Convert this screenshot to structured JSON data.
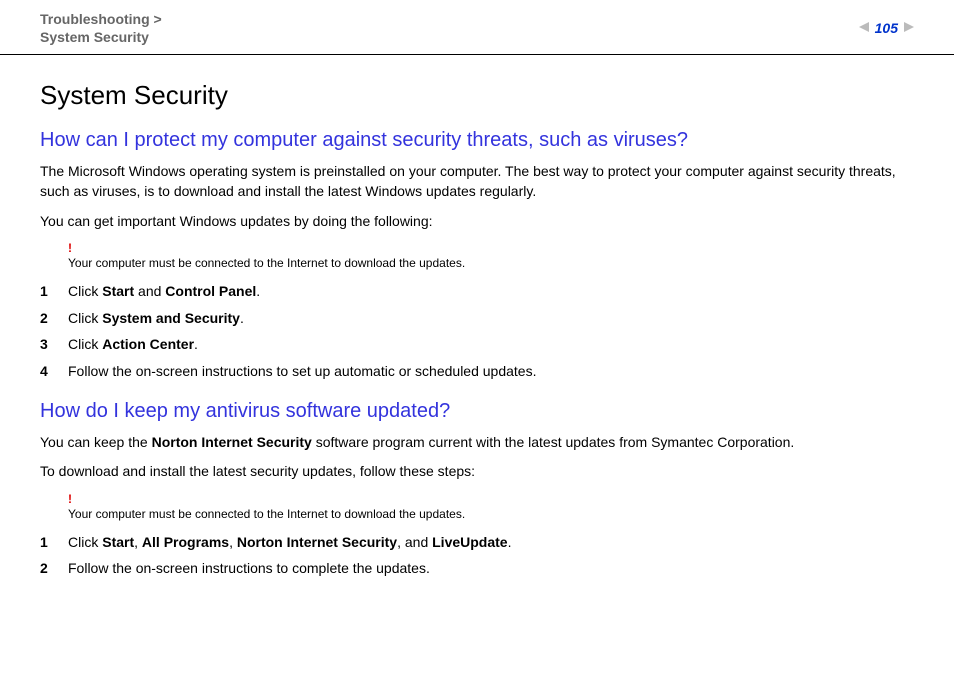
{
  "header": {
    "breadcrumb_line1": "Troubleshooting >",
    "breadcrumb_line2": "System Security",
    "page_number": "105"
  },
  "title": "System Security",
  "section1": {
    "heading": "How can I protect my computer against security threats, such as viruses?",
    "para1": "The Microsoft Windows operating system is preinstalled on your computer. The best way to protect your computer against security threats, such as viruses, is to download and install the latest Windows updates regularly.",
    "para2": "You can get important Windows updates by doing the following:",
    "warning_mark": "!",
    "warning_text": "Your computer must be connected to the Internet to download the updates.",
    "steps": [
      {
        "num": "1",
        "pre": "Click ",
        "b1": "Start",
        "mid1": " and ",
        "b2": "Control Panel",
        "post": "."
      },
      {
        "num": "2",
        "pre": "Click ",
        "b1": "System and Security",
        "post": "."
      },
      {
        "num": "3",
        "pre": "Click ",
        "b1": "Action Center",
        "post": "."
      },
      {
        "num": "4",
        "pre": "Follow the on-screen instructions to set up automatic or scheduled updates."
      }
    ]
  },
  "section2": {
    "heading": "How do I keep my antivirus software updated?",
    "para1_pre": "You can keep the ",
    "para1_b": "Norton Internet Security",
    "para1_post": " software program current with the latest updates from Symantec Corporation.",
    "para2": "To download and install the latest security updates, follow these steps:",
    "warning_mark": "!",
    "warning_text": "Your computer must be connected to the Internet to download the updates.",
    "steps": [
      {
        "num": "1",
        "pre": "Click ",
        "b1": "Start",
        "mid1": ", ",
        "b2": "All Programs",
        "mid2": ", ",
        "b3": "Norton Internet Security",
        "mid3": ", and ",
        "b4": "LiveUpdate",
        "post": "."
      },
      {
        "num": "2",
        "pre": "Follow the on-screen instructions to complete the updates."
      }
    ]
  }
}
